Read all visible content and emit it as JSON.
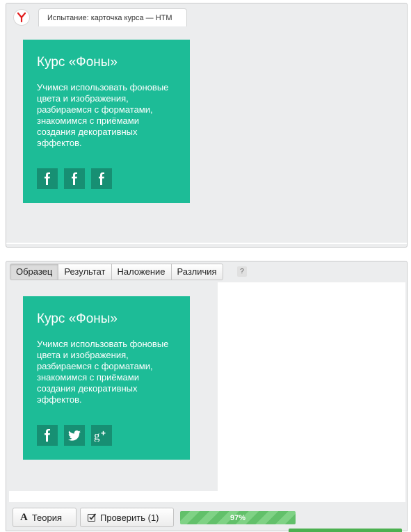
{
  "browser": {
    "tab_title": "Испытание: карточка курса — HTM"
  },
  "card": {
    "title": "Курс «Фоны»",
    "description": "Учимся использовать фоновые цвета и изображения, разбираемся с форматами, знакомимся с приёмами создания декоративных эффектов."
  },
  "top_card_socials": [
    "facebook-icon",
    "facebook-icon",
    "facebook-icon"
  ],
  "bottom_card_socials": [
    "facebook-icon",
    "twitter-icon",
    "google-plus-icon"
  ],
  "tabs": [
    {
      "label": "Образец",
      "active": true
    },
    {
      "label": "Результат",
      "active": false
    },
    {
      "label": "Наложение",
      "active": false
    },
    {
      "label": "Различия",
      "active": false
    }
  ],
  "help_label": "?",
  "buttons": {
    "theory": "Теория",
    "check": "Проверить (1)"
  },
  "progress": {
    "label": "97%",
    "value": 0.97
  },
  "colors": {
    "card_bg": "#1dbc97",
    "social_bg": "#178f73",
    "progress": "#62c06a"
  }
}
